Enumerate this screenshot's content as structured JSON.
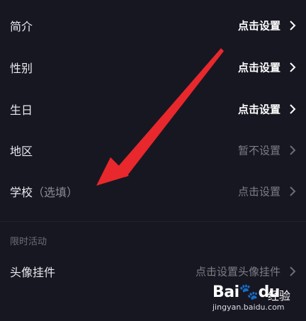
{
  "rows": [
    {
      "label": "简介",
      "value": "点击设置"
    },
    {
      "label": "性别",
      "value": "点击设置"
    },
    {
      "label": "生日",
      "value": "点击设置"
    },
    {
      "label": "地区",
      "value": "暂不设置"
    },
    {
      "label": "学校",
      "label_hint": "（选填）",
      "value": "点击设置"
    }
  ],
  "section": {
    "title": "限时活动",
    "rows": [
      {
        "label": "头像挂件",
        "value": "点击设置头像挂件"
      }
    ]
  },
  "watermark": {
    "logo": "Bai",
    "logo_tail": "du",
    "text": "经验",
    "url": "jingyan.baidu.com"
  },
  "colors": {
    "background": "#171722",
    "annotation_arrow": "#e8282c",
    "active_value": "#ffffff",
    "muted_value": "#7d7d88"
  },
  "icons": {
    "row_chevron": "chevron-right-icon",
    "annotation": "red-arrow-icon"
  }
}
